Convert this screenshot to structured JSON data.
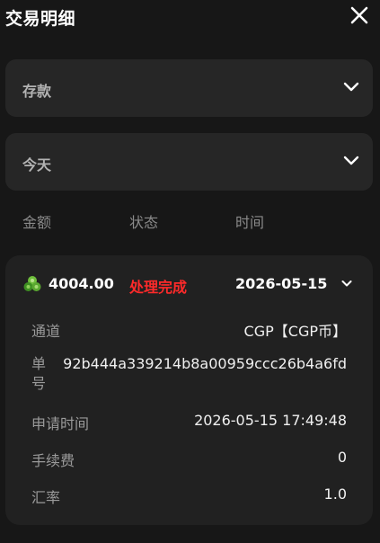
{
  "header": {
    "title": "交易明细"
  },
  "filters": {
    "type_label": "存款",
    "date_label": "今天"
  },
  "columns": {
    "amount": "金额",
    "status": "状态",
    "time": "时间"
  },
  "record": {
    "amount": "4004.00",
    "status": "处理完成",
    "date": "2026-05-15",
    "status_color": "#ff2a2a",
    "details": {
      "channel_label": "通道",
      "channel_value": "CGP【CGP币】",
      "order_label": "单号",
      "order_value": "92b444a339214b8a00959ccc26b4a6fd",
      "apply_time_label": "申请时间",
      "apply_time_value": "2026-05-15 17:49:48",
      "fee_label": "手续费",
      "fee_value": "0",
      "rate_label": "汇率",
      "rate_value": "1.0"
    }
  },
  "icons": {
    "close": "close-icon",
    "dropdown": "chevron-down-icon",
    "coin": "coin-stack-icon"
  }
}
